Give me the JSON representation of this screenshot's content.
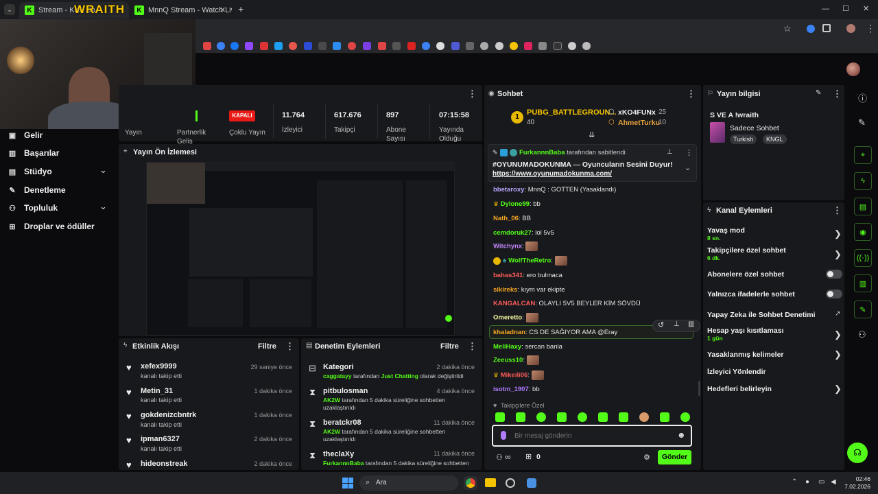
{
  "browser": {
    "tabs": [
      {
        "title": "Stream - Kick Da"
      },
      {
        "title": "MnnQ Stream - Watch Live on "
      }
    ],
    "new_tab": "+",
    "window_controls": [
      "—",
      "☐",
      "✕"
    ]
  },
  "overlay": {
    "brand": "WRAITH"
  },
  "sidebar": {
    "items": [
      {
        "label": "Gelir",
        "icon": "income-icon"
      },
      {
        "label": "Başarılar",
        "icon": "trophy-icon"
      },
      {
        "label": "Stüdyo",
        "icon": "studio-icon"
      },
      {
        "label": "Denetleme",
        "icon": "wrench-icon"
      },
      {
        "label": "Topluluk",
        "icon": "people-icon"
      },
      {
        "label": "Droplar ve ödüller",
        "icon": "gift-icon"
      }
    ]
  },
  "stats": {
    "partial_labels": [
      "Yayın",
      "Partnerlik Geliş"
    ],
    "status_badge": "KAPALI",
    "multi_label": "Çoklu Yayın",
    "items": [
      {
        "value": "11.764",
        "label": "İzleyici"
      },
      {
        "value": "617.676",
        "label": "Takipçi"
      },
      {
        "value": "897",
        "label": "Abone Sayısı"
      },
      {
        "value": "07:15:58",
        "label": "Yayında Olduğu"
      }
    ]
  },
  "preview": {
    "title": "Yayın Ön İzlemesi"
  },
  "activity": {
    "title": "Etkinlik Akışı",
    "filter": "Filtre",
    "items": [
      {
        "name": "xefex9999",
        "sub": "kanalı takip etti",
        "time": "29 saniye önce"
      },
      {
        "name": "Metin_31",
        "sub": "kanalı takip etti",
        "time": "1 dakika önce"
      },
      {
        "name": "gokdenizcbntrk",
        "sub": "kanalı takip etti",
        "time": "1 dakika önce"
      },
      {
        "name": "ipman6327",
        "sub": "kanalı takip etti",
        "time": "2 dakika önce"
      },
      {
        "name": "hideonstreak",
        "sub": "",
        "time": "2 dakika önce"
      }
    ]
  },
  "moderation": {
    "title": "Denetim Eylemleri",
    "filter": "Filtre",
    "items": [
      {
        "title": "Kategori",
        "time": "2 dakika önce",
        "user": "caggatayy",
        "text": " tarafından ",
        "extra": "Just Chatting",
        "text2": " olarak değiştirildi",
        "line2": ""
      },
      {
        "title": "pitbulosman",
        "time": "4 dakika önce",
        "user": "AK2W",
        "text": " tarafından 5 dakika süreliğine sohbetten",
        "extra": "",
        "text2": "",
        "line2": "uzaklaştırıldı"
      },
      {
        "title": "beratckr08",
        "time": "11 dakika önce",
        "user": "AK2W",
        "text": " tarafından 5 dakika süreliğine sohbetten",
        "extra": "",
        "text2": "",
        "line2": "uzaklaştırıldı"
      },
      {
        "title": "theclaXy",
        "time": "11 dakika önce",
        "user": "FurkannnBaba",
        "text": " tarafından 5 dakika süreliğine sohbetten",
        "extra": "",
        "text2": "",
        "line2": ""
      }
    ]
  },
  "chat": {
    "title": "Sohbet",
    "top": {
      "first_name": "PUBG_BATTLEGROUN...",
      "first_value": "40",
      "first_rank": "1",
      "second_name": "xKO4FUNx",
      "second_value": "25",
      "third_name": "AhmetTurku",
      "third_value": "10"
    },
    "pinned": {
      "by": "FurkannnBaba",
      "by_suffix": " tarafından sabitlendi",
      "text": "#OYUNUMADOKUNMA — Oyuncuların Sesini Duyur!",
      "link": "https://www.oyunumadokunma.com/"
    },
    "messages": [
      {
        "user": "bbetaroxy",
        "color": "#b9a7ff",
        "text": "MnnQ : GOTTEN (Yasaklandı)"
      },
      {
        "user": "Dylone99",
        "color": "#53fc18",
        "text": "bb"
      },
      {
        "user": "Nath_06",
        "color": "#f5a623",
        "text": "BB"
      },
      {
        "user": "cemdoruk27",
        "color": "#53fc18",
        "text": "lol 5v5"
      },
      {
        "user": "Witchynx",
        "color": "#c386ff",
        "text": ""
      },
      {
        "user": "WolfTheRetro",
        "color": "#53fc18",
        "text": ""
      },
      {
        "user": "bahas341",
        "color": "#ff5b5b",
        "text": "ero bulmaca"
      },
      {
        "user": "sikireks",
        "color": "#f5a623",
        "text": "kıym var ekipte"
      },
      {
        "user": "KANGALCAN",
        "color": "#ff5b5b",
        "text": "OLAYLI 5V5 BEYLER KİM SÖVDÜ"
      },
      {
        "user": "Omeretto",
        "color": "#f5f5a0",
        "text": ""
      },
      {
        "user": "khaladnan",
        "color": "#f5a623",
        "text": "CS DE SAĞIYOR AMA @Eray"
      },
      {
        "user": "MeliHaxy",
        "color": "#53fc18",
        "text": "sercan banla"
      },
      {
        "user": "Zeeuss10",
        "color": "#53fc18",
        "text": ""
      },
      {
        "user": "Mikeili06",
        "color": "#ff5b5b",
        "text": ""
      },
      {
        "user": "isotm_1907",
        "color": "#b07bff",
        "text": "bb"
      }
    ],
    "followers_only": "Takipçilere Özel",
    "input_placeholder": "Bir mesaj gönderin",
    "points": "0",
    "send_label": "Gönder"
  },
  "stream_info": {
    "title": "Yayın bilgisi",
    "stream_title": "S VE A !wraith",
    "mode": "Sadece Sohbet",
    "tags": [
      "Turkish",
      "KNGL"
    ]
  },
  "channel_actions": {
    "title": "Kanal Eylemleri",
    "items": [
      {
        "label": "Yavaş mod",
        "sub": "8 sn.",
        "control": "chevron"
      },
      {
        "label": "Takipçilere özel sohbet",
        "sub": "6 dk.",
        "control": "chevron"
      },
      {
        "label": "Abonelere özel sohbet",
        "sub": "",
        "control": "toggle"
      },
      {
        "label": "Yalnızca ifadelerle sohbet",
        "sub": "",
        "control": "toggle"
      },
      {
        "label": "Yapay Zeka ile Sohbet Denetimi",
        "sub": "",
        "control": "external"
      },
      {
        "label": "Hesap yaşı kısıtlaması",
        "sub": "1 gün",
        "control": "chevron"
      },
      {
        "label": "Yasaklanmış kelimeler",
        "sub": "",
        "control": "chevron"
      },
      {
        "label": "İzleyici Yönlendir",
        "sub": "",
        "control": "none"
      },
      {
        "label": "Hedefleri belirleyin",
        "sub": "",
        "control": "chevron"
      }
    ]
  },
  "taskbar": {
    "search": "Ara",
    "time": "02:46",
    "date": "7.02.2026"
  },
  "colors": {
    "accent": "#53fc18",
    "panel": "#18191c",
    "bg": "#0b0b0d",
    "live_red": "#e91916"
  }
}
